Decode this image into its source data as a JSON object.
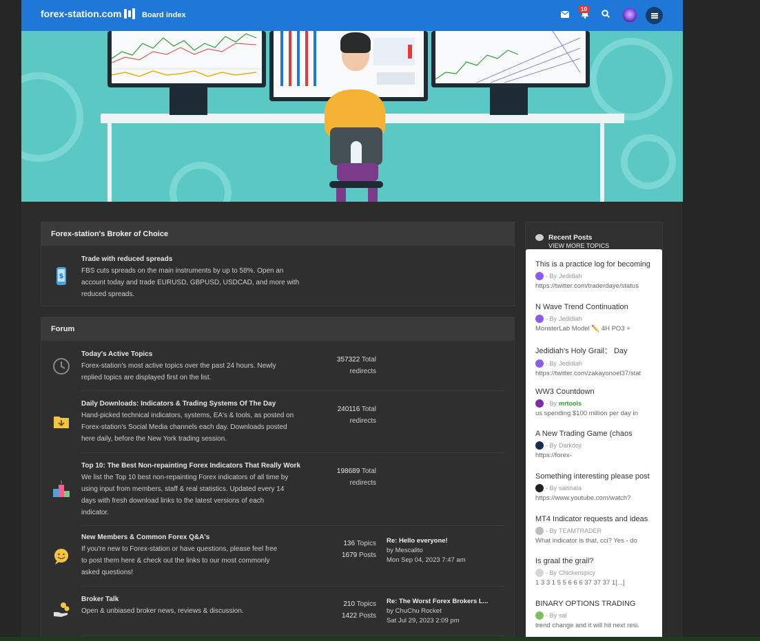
{
  "header": {
    "logo_text": "forex-station.com",
    "board_index": "Board index",
    "notification_count": "10",
    "colors": {
      "bar": "#1f77d8",
      "badge": "#e53935"
    },
    "icons": [
      "envelope-icon",
      "bell-icon",
      "search-icon",
      "avatar",
      "hamburger-icon"
    ]
  },
  "broker_panel": {
    "heading": "Forex-station's Broker of Choice",
    "title": "Trade with reduced spreads",
    "desc_lines": [
      "FBS cuts spreads on the main instruments by up to 58%. Open an",
      "account today and trade EURUSD, GBPUSD, USDCAD, and more with",
      "reduced spreads."
    ]
  },
  "forum_panel": {
    "heading": "Forum",
    "rows": [
      {
        "title": "Today's Active Topics",
        "desc_lines": [
          "Forex-station's most active topics over the past 24 hours. Newly",
          "replied topics are displayed first on the list."
        ],
        "stat_value": "357322",
        "stat_label1": "Total",
        "stat_label2": "redirects"
      },
      {
        "title": "Daily Downloads: Indicators & Trading Systems Of The Day",
        "desc_lines": [
          "Hand-picked technical indicators, systems, EA's & tools, as posted on",
          "Forex-station's Social Media channels each day. Downloads posted",
          "here daily, before the New York trading session."
        ],
        "stat_value": "240116",
        "stat_label1": "Total",
        "stat_label2": "redirects"
      },
      {
        "title": "Top 10: The Best Non-repainting Forex Indicators That Really Work",
        "desc_lines": [
          "We list the Top 10 best non-repainting Forex indicators of all time by",
          "using input from members, staff & real statistics. Updated every 14",
          "days with fresh download links to the latest versions of each",
          "indicator."
        ],
        "stat_value": "198689",
        "stat_label1": "Total",
        "stat_label2": "redirects"
      },
      {
        "title": "New Members & Common Forex Q&A's",
        "desc_lines": [
          "If you're new to Forex-station or have questions, please feel free",
          "to post them here & check out the links to our most commonly",
          "asked questions!"
        ],
        "topics": "136",
        "topics_label": "Topics",
        "posts": "1679",
        "posts_label": "Posts",
        "last_title": "Re: Hello everyone!",
        "last_by": "by Mescalito",
        "last_date": "Mon Sep 04, 2023 7:47 am"
      },
      {
        "title": "Broker Talk",
        "desc_lines": [
          "Open & unbiased broker news, reviews & discussion."
        ],
        "topics": "210",
        "topics_label": "Topics",
        "posts": "1422",
        "posts_label": "Posts",
        "last_title": "Re: The Worst Forex Brokers L...",
        "last_by": "by ChuChu Rocket",
        "last_date": "Sat Jul 29, 2023 2:09 pm"
      }
    ]
  },
  "recent": {
    "heading": "Recent Posts",
    "view_more": "VIEW MORE TOPICS",
    "posts": [
      {
        "title": "This is a practice log for becoming",
        "by": "- By",
        "user": "Jedidiah",
        "excerpt": "https://twitter.com/traderdaye/status",
        "avatar_color": "#8a5cf0"
      },
      {
        "title": "N Wave Trend Continuation",
        "by": "- By",
        "user": "Jedidiah",
        "excerpt": "MonsterLab Model ✏️ 4H PO3 +",
        "avatar_color": "#8a5cf0"
      },
      {
        "title": "Jedidiah's Holy Grail：  Day",
        "by": "- By",
        "user": "Jedidiah",
        "excerpt": "https://twitter.com/zakayonoel37/stat",
        "avatar_color": "#8a5cf0"
      },
      {
        "title": "WW3 Countdown",
        "by": "- By",
        "user": "mrtools",
        "excerpt": "us spending $100 million per day in",
        "avatar_color": "#7a2ea8",
        "green": true
      },
      {
        "title": "A New Trading Game (chaos",
        "by": "- By",
        "user": "Darkdoji",
        "excerpt": "https://forex-",
        "avatar_color": "#1a2a4a"
      },
      {
        "title": "Something interesting please post",
        "by": "- By",
        "user": "saishala",
        "excerpt": "https://www.youtube.com/watch?",
        "avatar_color": "#222222"
      },
      {
        "title": "MT4 Indicator requests and ideas",
        "by": "- By",
        "user": "TEAMTRADER",
        "excerpt": "What indicator is that, cci? Yes - do",
        "avatar_color": "#bdbdbd"
      },
      {
        "title": "Is graal the grail?",
        "by": "- By",
        "user": "Chickenspicy",
        "excerpt": "1 3 3 1 5 5 6 6 6 37 37 37 1[...]",
        "avatar_color": "#d6d6d6"
      },
      {
        "title": "BINARY OPTIONS TRADING",
        "by": "- By",
        "user": "sal",
        "excerpt": "trend change and it will hit next resi.",
        "avatar_color": "#7fbf5f"
      }
    ]
  }
}
